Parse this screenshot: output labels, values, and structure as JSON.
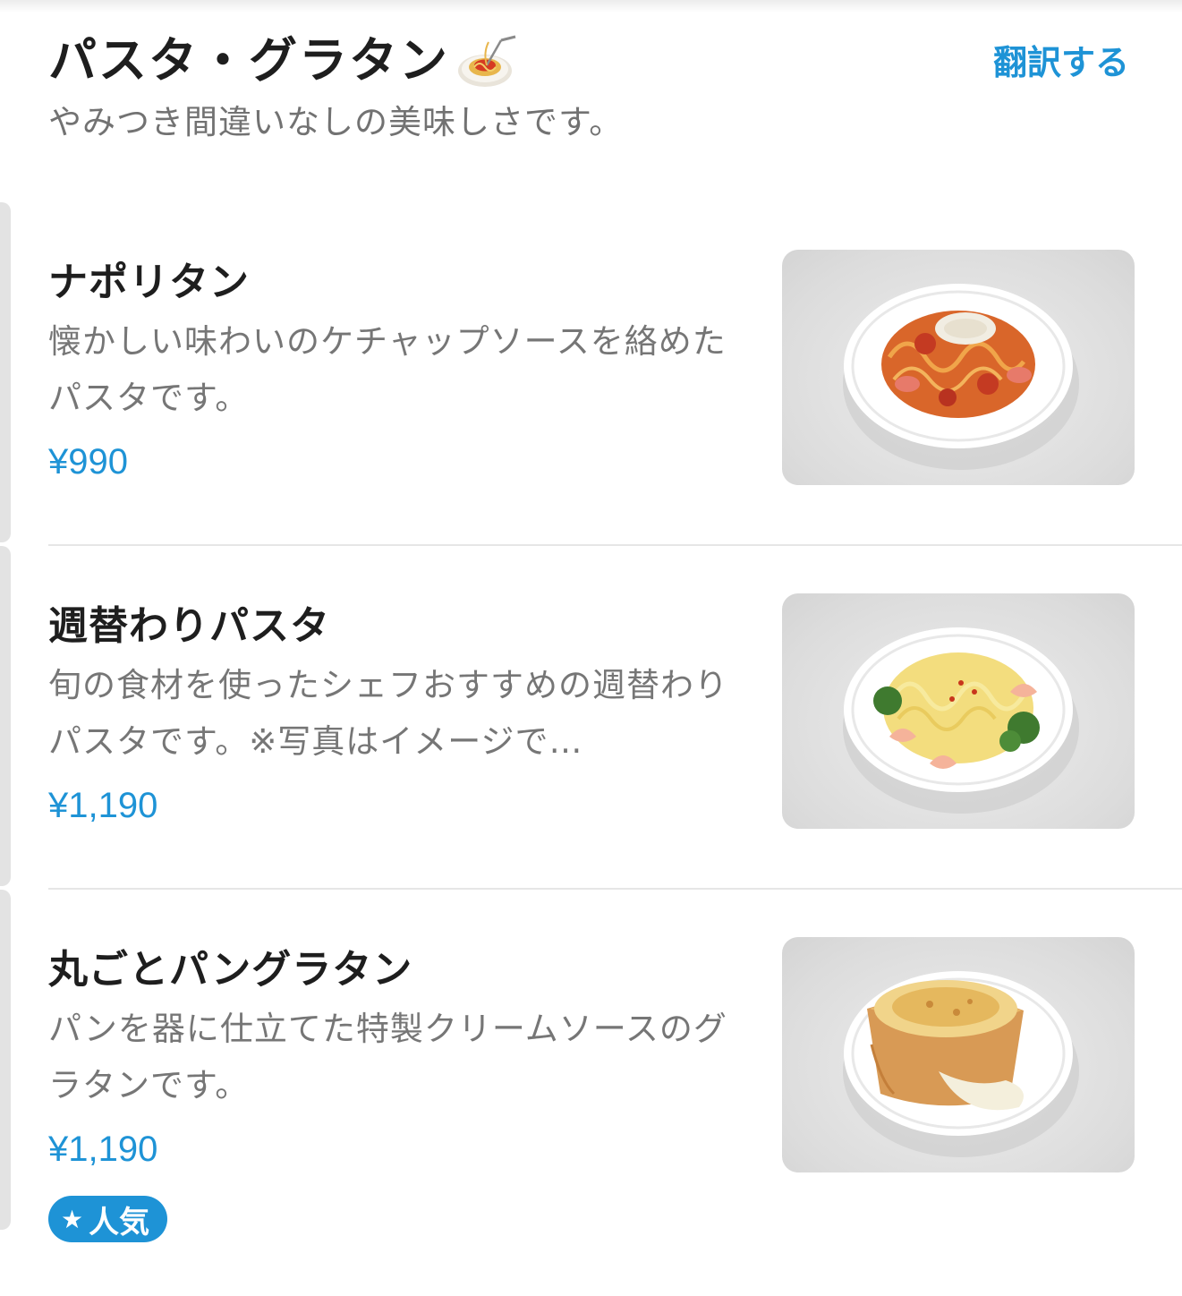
{
  "section": {
    "title": "パスタ・グラタン",
    "title_icon": "spaghetti-icon",
    "subtitle": "やみつき間違いなしの美味しさです。",
    "translate_label": "翻訳する"
  },
  "colors": {
    "accent": "#1e93d6",
    "title": "#1e1e1e",
    "muted": "#767676",
    "divider": "#e6e6e6",
    "image_bg": "#dcdcdc"
  },
  "items": [
    {
      "name": "ナポリタン",
      "description": "懐かしい味わいのケチャップソースを絡めたパスタです。",
      "price": "¥990",
      "image": "napolitan-dish-image"
    },
    {
      "name": "週替わりパスタ",
      "description": "旬の食材を使ったシェフおすすめの週替わりパスタです。※写真はイメージで…",
      "price": "¥1,190",
      "image": "weekly-pasta-dish-image"
    },
    {
      "name": "丸ごとパングラタン",
      "description": "パンを器に仕立てた特製クリームソースのグラタンです。",
      "price": "¥1,190",
      "image": "bread-gratin-dish-image",
      "badge": {
        "icon": "star-icon",
        "label": "人気"
      }
    }
  ]
}
